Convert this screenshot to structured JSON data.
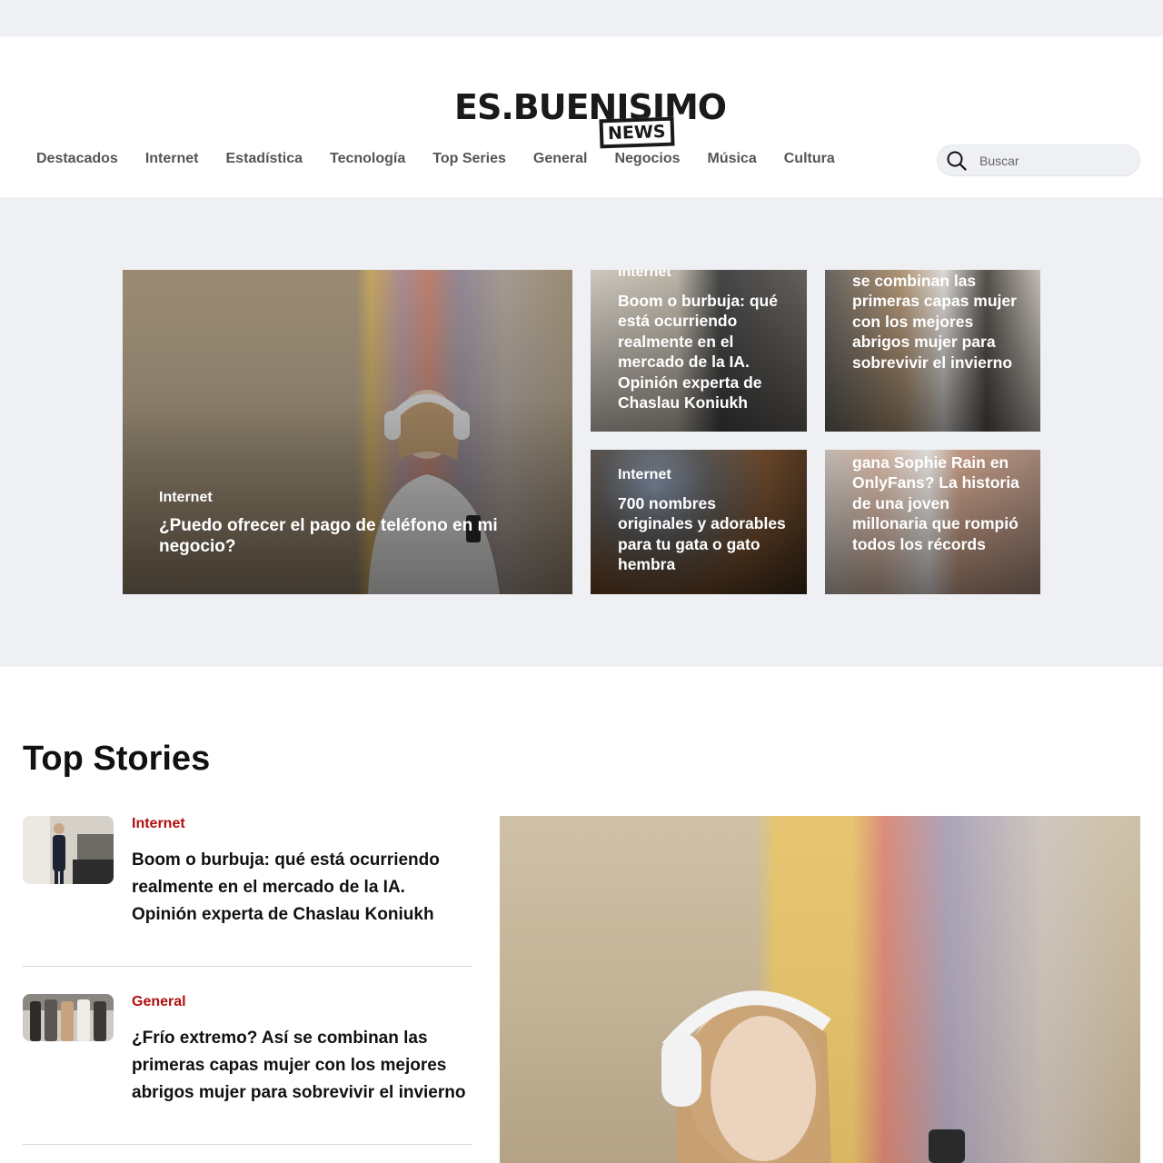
{
  "site": {
    "logo_main": "ES.BUENISIMO",
    "logo_sub": "NEWS"
  },
  "nav": {
    "items": [
      "Destacados",
      "Internet",
      "Estadística",
      "Tecnología",
      "Top Series",
      "General",
      "Negocios",
      "Música",
      "Cultura"
    ]
  },
  "search": {
    "placeholder": "Buscar"
  },
  "hero": {
    "main": {
      "category": "Internet",
      "title": "¿Puedo ofrecer el pago de teléfono en mi negocio?"
    },
    "cards": [
      {
        "category": "Internet",
        "title": "Boom o burbuja: qué está ocurriendo realmente en el mercado de la IA. Opinión experta de Chaslau Koniukh"
      },
      {
        "category": "",
        "title": "se combinan las primeras capas mujer con los mejores abrigos mujer para sobrevivir el invierno"
      },
      {
        "category": "Internet",
        "title": "700 nombres originales y adorables para tu gata o gato hembra"
      },
      {
        "category": "",
        "title": "gana Sophie Rain en OnlyFans? La historia de una joven millonaria que rompió todos los récords"
      }
    ]
  },
  "top_stories": {
    "heading": "Top Stories",
    "items": [
      {
        "category": "Internet",
        "title": "Boom o burbuja: qué está ocurriendo realmente en el mercado de la IA. Opinión experta de Chaslau Koniukh"
      },
      {
        "category": "General",
        "title": "¿Frío extremo? Así se combinan las primeras capas mujer con los mejores abrigos mujer para sobrevivir el invierno"
      }
    ]
  },
  "colors": {
    "accent_category": "#b30e0e",
    "band_background": "#eef0f4"
  }
}
